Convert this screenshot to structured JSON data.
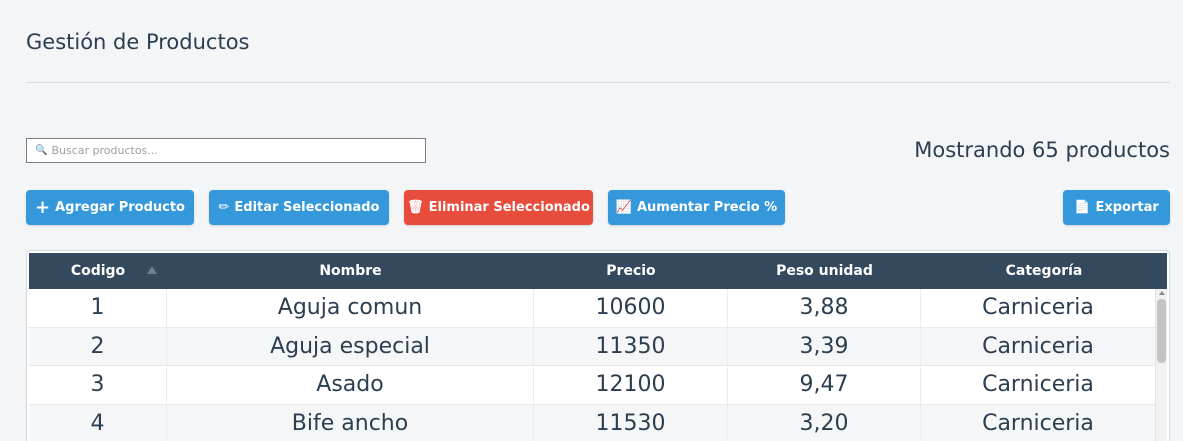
{
  "header": {
    "title": "Gestión de Productos"
  },
  "search": {
    "placeholder": "Buscar productos...",
    "value": ""
  },
  "count_label": "Mostrando 65 productos",
  "toolbar": {
    "add": {
      "icon": "plus-icon",
      "glyph": "+",
      "label": "Agregar Producto"
    },
    "edit": {
      "icon": "pencil-icon",
      "glyph": "✏",
      "label": "Editar Seleccionado"
    },
    "delete": {
      "icon": "trash-icon",
      "glyph": "🗑",
      "label": "Eliminar Seleccionado"
    },
    "increase": {
      "icon": "chart-up-icon",
      "glyph": "📈",
      "label": "Aumentar Precio %"
    },
    "export": {
      "icon": "document-icon",
      "glyph": "📄",
      "label": "Exportar"
    }
  },
  "table": {
    "columns": [
      "Codigo",
      "Nombre",
      "Precio",
      "Peso unidad",
      "Categoría"
    ],
    "sort": {
      "column": "Codigo",
      "direction": "asc"
    },
    "rows": [
      [
        "1",
        "Aguja comun",
        "10600",
        "3,88",
        "Carniceria"
      ],
      [
        "2",
        "Aguja especial",
        "11350",
        "3,39",
        "Carniceria"
      ],
      [
        "3",
        "Asado",
        "12100",
        "9,47",
        "Carniceria"
      ],
      [
        "4",
        "Bife ancho",
        "11530",
        "3,20",
        "Carniceria"
      ]
    ]
  },
  "colors": {
    "primary": "#3498db",
    "danger": "#e74c3c",
    "table_header": "#34495e",
    "text": "#2c3e50"
  }
}
